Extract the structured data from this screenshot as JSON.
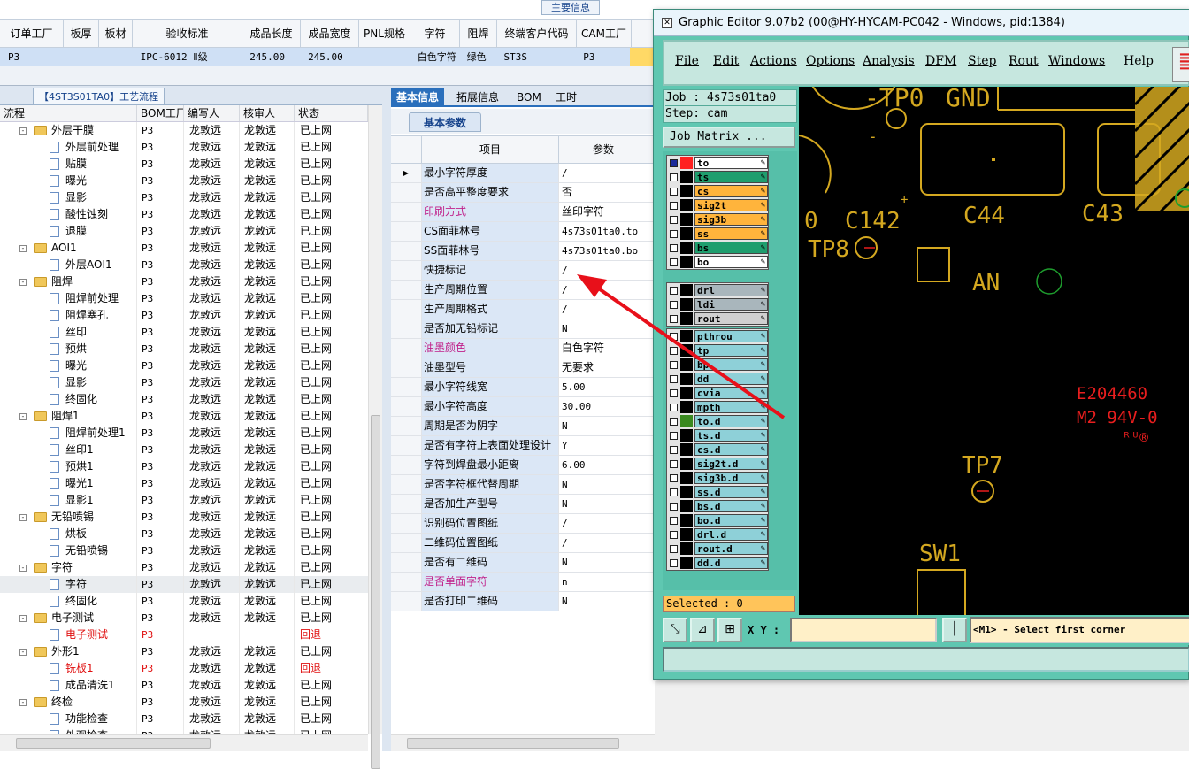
{
  "top": {
    "section_title": "主要信息",
    "headers": [
      "订单工厂",
      "板厚",
      "板材",
      "验收标准",
      "成品长度",
      "成品宽度",
      "PNL规格",
      "字符",
      "阻焊",
      "终端客户代码",
      "CAM工厂"
    ],
    "row": [
      "P3",
      "",
      "",
      "IPC-6012 Ⅱ级",
      "245.00",
      "245.00",
      "",
      "白色字符",
      "绿色",
      "ST3S",
      "P3"
    ]
  },
  "left": {
    "tab": "【4ST3S01TA0】工艺流程",
    "headers": [
      "流程",
      "BOM工厂",
      "编写人",
      "核审人",
      "状态"
    ],
    "rows": [
      {
        "level": 1,
        "type": "folder",
        "name": "外层干膜",
        "f": "P3",
        "w": "龙敦远",
        "r": "龙敦远",
        "s": "已上网"
      },
      {
        "level": 2,
        "type": "doc",
        "name": "外层前处理",
        "f": "P3",
        "w": "龙敦远",
        "r": "龙敦远",
        "s": "已上网"
      },
      {
        "level": 2,
        "type": "doc",
        "name": "贴膜",
        "f": "P3",
        "w": "龙敦远",
        "r": "龙敦远",
        "s": "已上网"
      },
      {
        "level": 2,
        "type": "doc",
        "name": "曝光",
        "f": "P3",
        "w": "龙敦远",
        "r": "龙敦远",
        "s": "已上网"
      },
      {
        "level": 2,
        "type": "doc",
        "name": "显影",
        "f": "P3",
        "w": "龙敦远",
        "r": "龙敦远",
        "s": "已上网"
      },
      {
        "level": 2,
        "type": "doc",
        "name": "酸性蚀刻",
        "f": "P3",
        "w": "龙敦远",
        "r": "龙敦远",
        "s": "已上网"
      },
      {
        "level": 2,
        "type": "doc",
        "name": "退膜",
        "f": "P3",
        "w": "龙敦远",
        "r": "龙敦远",
        "s": "已上网"
      },
      {
        "level": 1,
        "type": "folder",
        "name": "AOI1",
        "f": "P3",
        "w": "龙敦远",
        "r": "龙敦远",
        "s": "已上网"
      },
      {
        "level": 2,
        "type": "doc",
        "name": "外层AOI1",
        "f": "P3",
        "w": "龙敦远",
        "r": "龙敦远",
        "s": "已上网"
      },
      {
        "level": 1,
        "type": "folder",
        "name": "阻焊",
        "f": "P3",
        "w": "龙敦远",
        "r": "龙敦远",
        "s": "已上网"
      },
      {
        "level": 2,
        "type": "doc",
        "name": "阻焊前处理",
        "f": "P3",
        "w": "龙敦远",
        "r": "龙敦远",
        "s": "已上网"
      },
      {
        "level": 2,
        "type": "doc",
        "name": "阻焊塞孔",
        "f": "P3",
        "w": "龙敦远",
        "r": "龙敦远",
        "s": "已上网"
      },
      {
        "level": 2,
        "type": "doc",
        "name": "丝印",
        "f": "P3",
        "w": "龙敦远",
        "r": "龙敦远",
        "s": "已上网"
      },
      {
        "level": 2,
        "type": "doc",
        "name": "预烘",
        "f": "P3",
        "w": "龙敦远",
        "r": "龙敦远",
        "s": "已上网"
      },
      {
        "level": 2,
        "type": "doc",
        "name": "曝光",
        "f": "P3",
        "w": "龙敦远",
        "r": "龙敦远",
        "s": "已上网"
      },
      {
        "level": 2,
        "type": "doc",
        "name": "显影",
        "f": "P3",
        "w": "龙敦远",
        "r": "龙敦远",
        "s": "已上网"
      },
      {
        "level": 2,
        "type": "doc",
        "name": "终固化",
        "f": "P3",
        "w": "龙敦远",
        "r": "龙敦远",
        "s": "已上网"
      },
      {
        "level": 1,
        "type": "folder",
        "name": "阻焊1",
        "f": "P3",
        "w": "龙敦远",
        "r": "龙敦远",
        "s": "已上网"
      },
      {
        "level": 2,
        "type": "doc",
        "name": "阻焊前处理1",
        "f": "P3",
        "w": "龙敦远",
        "r": "龙敦远",
        "s": "已上网"
      },
      {
        "level": 2,
        "type": "doc",
        "name": "丝印1",
        "f": "P3",
        "w": "龙敦远",
        "r": "龙敦远",
        "s": "已上网"
      },
      {
        "level": 2,
        "type": "doc",
        "name": "预烘1",
        "f": "P3",
        "w": "龙敦远",
        "r": "龙敦远",
        "s": "已上网"
      },
      {
        "level": 2,
        "type": "doc",
        "name": "曝光1",
        "f": "P3",
        "w": "龙敦远",
        "r": "龙敦远",
        "s": "已上网"
      },
      {
        "level": 2,
        "type": "doc",
        "name": "显影1",
        "f": "P3",
        "w": "龙敦远",
        "r": "龙敦远",
        "s": "已上网"
      },
      {
        "level": 1,
        "type": "folder",
        "name": "无铅喷锡",
        "f": "P3",
        "w": "龙敦远",
        "r": "龙敦远",
        "s": "已上网"
      },
      {
        "level": 2,
        "type": "doc",
        "name": "烘板",
        "f": "P3",
        "w": "龙敦远",
        "r": "龙敦远",
        "s": "已上网"
      },
      {
        "level": 2,
        "type": "doc",
        "name": "无铅喷锡",
        "f": "P3",
        "w": "龙敦远",
        "r": "龙敦远",
        "s": "已上网"
      },
      {
        "level": 1,
        "type": "folder",
        "name": "字符",
        "f": "P3",
        "w": "龙敦远",
        "r": "龙敦远",
        "s": "已上网"
      },
      {
        "level": 2,
        "type": "doc",
        "name": "字符",
        "f": "P3",
        "w": "龙敦远",
        "r": "龙敦远",
        "s": "已上网",
        "sel": true
      },
      {
        "level": 2,
        "type": "doc",
        "name": "终固化",
        "f": "P3",
        "w": "龙敦远",
        "r": "龙敦远",
        "s": "已上网"
      },
      {
        "level": 1,
        "type": "folder",
        "name": "电子测试",
        "f": "P3",
        "w": "龙敦远",
        "r": "龙敦远",
        "s": "已上网"
      },
      {
        "level": 2,
        "type": "doc",
        "name": "电子测试",
        "f": "P3",
        "w": "",
        "r": "",
        "s": "回退",
        "red": true
      },
      {
        "level": 1,
        "type": "folder",
        "name": "外形1",
        "f": "P3",
        "w": "龙敦远",
        "r": "龙敦远",
        "s": "已上网"
      },
      {
        "level": 2,
        "type": "doc",
        "name": "铣板1",
        "f": "P3",
        "w": "龙敦远",
        "r": "龙敦远",
        "s": "回退",
        "red": true
      },
      {
        "level": 2,
        "type": "doc",
        "name": "成品清洗1",
        "f": "P3",
        "w": "龙敦远",
        "r": "龙敦远",
        "s": "已上网"
      },
      {
        "level": 1,
        "type": "folder",
        "name": "终检",
        "f": "P3",
        "w": "龙敦远",
        "r": "龙敦远",
        "s": "已上网"
      },
      {
        "level": 2,
        "type": "doc",
        "name": "功能检查",
        "f": "P3",
        "w": "龙敦远",
        "r": "龙敦远",
        "s": "已上网"
      },
      {
        "level": 2,
        "type": "doc",
        "name": "外观检查",
        "f": "P3",
        "w": "龙敦远",
        "r": "龙敦远",
        "s": "已上网"
      }
    ]
  },
  "middle": {
    "tabs": [
      "基本信息",
      "拓展信息",
      "BOM",
      "工时"
    ],
    "subtab": "基本参数",
    "col_item": "项目",
    "col_param": "参数",
    "rows": [
      {
        "k": "最小字符厚度",
        "v": "/"
      },
      {
        "k": "是否高平整度要求",
        "v": "否",
        "cn": true
      },
      {
        "k": "印刷方式",
        "v": "丝印字符",
        "cn": true,
        "pink": true
      },
      {
        "k": "CS面菲林号",
        "v": "4s73s01ta0.to"
      },
      {
        "k": "SS面菲林号",
        "v": "4s73s01ta0.bo"
      },
      {
        "k": "快捷标记",
        "v": "/"
      },
      {
        "k": "生产周期位置",
        "v": "/"
      },
      {
        "k": "生产周期格式",
        "v": "/"
      },
      {
        "k": "是否加无铅标记",
        "v": "N"
      },
      {
        "k": "油墨颜色",
        "v": "白色字符",
        "cn": true,
        "pink": true
      },
      {
        "k": "油墨型号",
        "v": "无要求",
        "cn": true
      },
      {
        "k": "最小字符线宽",
        "v": "5.00"
      },
      {
        "k": "最小字符高度",
        "v": "30.00"
      },
      {
        "k": "周期是否为阴字",
        "v": "N"
      },
      {
        "k": "是否有字符上表面处理设计",
        "v": "Y"
      },
      {
        "k": "字符到焊盘最小距离",
        "v": "6.00"
      },
      {
        "k": "是否字符框代替周期",
        "v": "N"
      },
      {
        "k": "是否加生产型号",
        "v": "N"
      },
      {
        "k": "识别码位置图纸",
        "v": "/"
      },
      {
        "k": "二维码位置图纸",
        "v": "/"
      },
      {
        "k": "是否有二维码",
        "v": "N"
      },
      {
        "k": "是否单面字符",
        "v": "n",
        "pink": true
      },
      {
        "k": "是否打印二维码",
        "v": "N"
      }
    ]
  },
  "editor": {
    "title": "Graphic Editor 9.07b2 (00@HY-HYCAM-PC042 - Windows, pid:1384)",
    "menu": [
      "File",
      "Edit",
      "Actions",
      "Options",
      "Analysis",
      "DFM",
      "Step",
      "Rout",
      "Windows",
      "Help"
    ],
    "job_line": "Job : 4s73s01ta0",
    "step_line": "Step: cam",
    "job_matrix": "Job Matrix ...",
    "layers_board": [
      {
        "name": "to",
        "color": "#ffffff",
        "sw": "#ff2020"
      },
      {
        "name": "ts",
        "color": "#1f9e6e",
        "sw": "#000000"
      },
      {
        "name": "cs",
        "color": "#ffb43c",
        "sw": "#000000"
      },
      {
        "name": "sig2t",
        "color": "#ffb43c",
        "sw": "#000000"
      },
      {
        "name": "sig3b",
        "color": "#ffb43c",
        "sw": "#000000"
      },
      {
        "name": "ss",
        "color": "#ffb43c",
        "sw": "#000000"
      },
      {
        "name": "bs",
        "color": "#1f9e6e",
        "sw": "#000000"
      },
      {
        "name": "bo",
        "color": "#ffffff",
        "sw": "#000000"
      }
    ],
    "layers_drill": [
      {
        "name": "drl",
        "color": "#a9b6bc",
        "sw": "#000000"
      },
      {
        "name": "ldi",
        "color": "#a9b6bc",
        "sw": "#000000"
      },
      {
        "name": "rout",
        "color": "#d0d0d0",
        "sw": "#000000"
      }
    ],
    "layers_misc": [
      {
        "name": "pthrou",
        "color": "#8ed0d8",
        "sw": "#000000"
      },
      {
        "name": "tp",
        "color": "#8ed0d8",
        "sw": "#000000"
      },
      {
        "name": "bp",
        "color": "#8ed0d8",
        "sw": "#000000"
      },
      {
        "name": "dd",
        "color": "#8ed0d8",
        "sw": "#000000"
      },
      {
        "name": "cvia",
        "color": "#8ed0d8",
        "sw": "#000000"
      },
      {
        "name": "mpth",
        "color": "#8ed0d8",
        "sw": "#000000"
      },
      {
        "name": "to.d",
        "color": "#8ed0d8",
        "sw": "#3a8a20"
      },
      {
        "name": "ts.d",
        "color": "#8ed0d8",
        "sw": "#000000"
      },
      {
        "name": "cs.d",
        "color": "#8ed0d8",
        "sw": "#000000"
      },
      {
        "name": "sig2t.d",
        "color": "#8ed0d8",
        "sw": "#000000"
      },
      {
        "name": "sig3b.d",
        "color": "#8ed0d8",
        "sw": "#000000"
      },
      {
        "name": "ss.d",
        "color": "#8ed0d8",
        "sw": "#000000"
      },
      {
        "name": "bs.d",
        "color": "#8ed0d8",
        "sw": "#000000"
      },
      {
        "name": "bo.d",
        "color": "#8ed0d8",
        "sw": "#000000"
      },
      {
        "name": "drl.d",
        "color": "#8ed0d8",
        "sw": "#000000"
      },
      {
        "name": "rout.d",
        "color": "#8ed0d8",
        "sw": "#000000"
      },
      {
        "name": "dd.d",
        "color": "#8ed0d8",
        "sw": "#000000"
      }
    ],
    "selected": "Selected : 0",
    "xy_label": "X Y :",
    "prompt": "<M1> - Select first corner",
    "canvas_labels": {
      "tp0": "-TP0",
      "gnd": "GND",
      "o": "0",
      "c142": "C142",
      "c44": "C44",
      "c43": "C43",
      "tp8": "TP8",
      "an": "AN",
      "e204460": "E204460",
      "m2": "M2 94V-0",
      "ul": "ᴿᵁ®",
      "tp7": "TP7",
      "sw1": "SW1",
      "minus": "-",
      "plus": "+"
    },
    "colors": {
      "gold": "#d4a820",
      "red": "#e81e1e",
      "green": "#1e9e2e",
      "teal": "#5fc7b1",
      "arrow": "#e8101a"
    }
  }
}
